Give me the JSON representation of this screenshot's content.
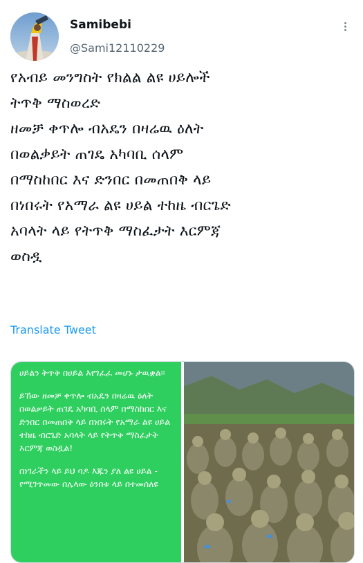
{
  "user": {
    "display_name": "Samibebi",
    "handle": "@Sami12110229"
  },
  "tweet": {
    "lines": [
      "የአብይ መንግስት የክልል ልዩ ሀይሎች",
      "ትጥቅ  ማስወረድ",
      "ዘመቻ ቀጥሎ ብአዴን በዛሬዉ ዕለት",
      "በወልቃይት ጠገዴ አካባቢ ሰላም",
      "በማስከበር እና ድንበር በመጠበቅ ላይ",
      "በነበሩት የአማራ ልዩ ሀይል ተከዜ ብርጌድ",
      "አባላት ላይ የትጥቅ ማስፈታት እርምጃ",
      "ወስዷ"
    ],
    "translate_label": "Translate Tweet"
  },
  "media": {
    "green_card_paragraphs": [
      "ሀይልን ትጥቅ በሀይል እየገፈፈ መሆኑ ታዉቋል፡፡",
      "ይኸው ዘመቻ ቀጥሎ ብአዴን በዛሬዉ ዕለት  በወልቃይት ጠገዴ አካባቢ ሰላም በማስከበር እና ድንበር በመጠበቅ ላይ በነበሩት የአማራ ልዩ ሀይል ተከዜ ብርጌድ አባላት ላይ የትጥቅ ማስፈታት እርምጃ ወስዷል!",
      "በነገራችን ላይ ይህ ባዶ እጁን ያለ ልዩ ሀይል - የሚገጥመው በሌላው ዕንበቱ ላይ በተመሰለዩ"
    ]
  },
  "colors": {
    "accent": "#1d9bf0",
    "green_card": "#2fcf5f",
    "secondary_text": "#536471"
  },
  "icons": {
    "more": "more-dots-icon"
  }
}
